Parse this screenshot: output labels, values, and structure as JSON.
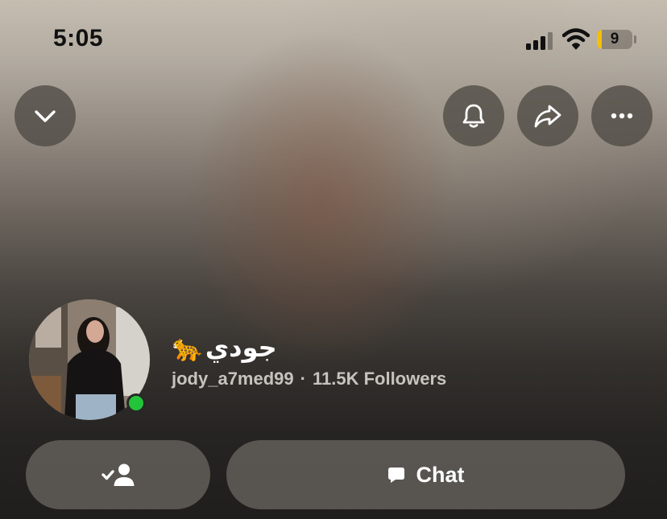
{
  "status_bar": {
    "time": "5:05",
    "battery_level": "9",
    "signal_icon": "cellular-signal-icon",
    "wifi_icon": "wifi-icon"
  },
  "header": {
    "collapse_icon": "chevron-down-icon",
    "notifications_icon": "bell-icon",
    "share_icon": "share-arrow-icon",
    "more_icon": "more-dots-icon"
  },
  "profile": {
    "display_name": "جودي",
    "name_emoji": "🐆",
    "username": "jody_a7med99",
    "separator": "·",
    "followers": "11.5K Followers",
    "online": true
  },
  "actions": {
    "friend_icon": "added-friend-icon",
    "chat_icon": "chat-bubble-icon",
    "chat_label": "Chat"
  },
  "colors": {
    "online": "#22c53a",
    "battery_accent": "#f2c00a",
    "button_bg": "#6e6a64"
  }
}
